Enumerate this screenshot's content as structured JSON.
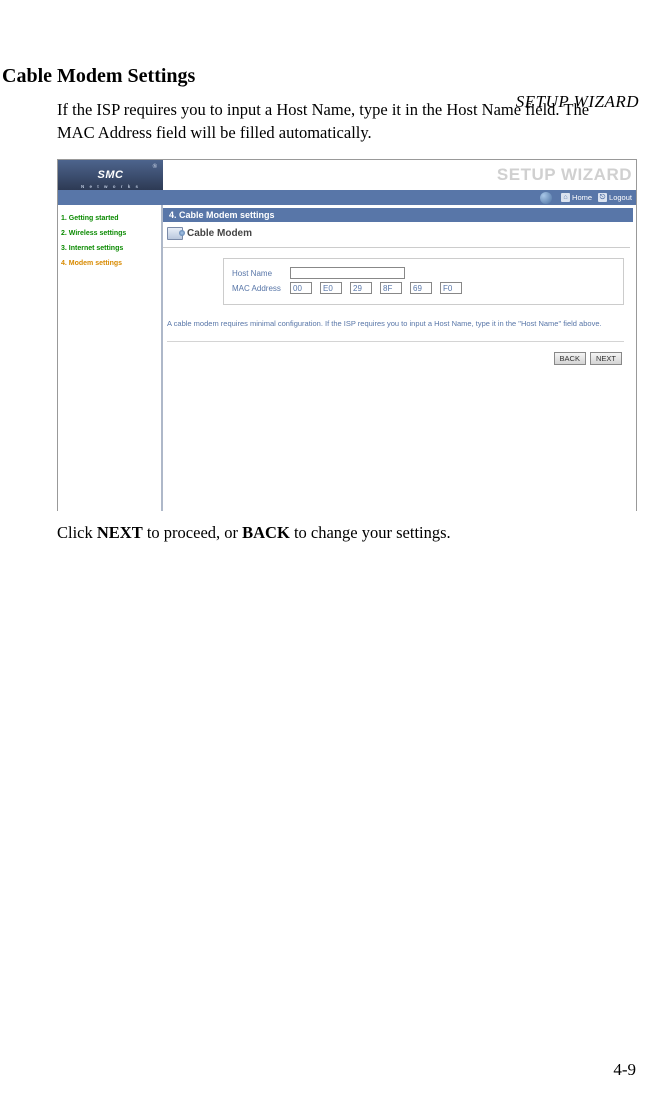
{
  "header": {
    "title": "SETUP WIZARD"
  },
  "section": {
    "heading": "Cable Modem Settings"
  },
  "intro": "If the ISP requires you to input a Host Name, type it in the Host Name field. The MAC Address field will be filled automatically.",
  "outro_parts": {
    "pre": "Click ",
    "b1": "NEXT",
    "mid": " to proceed, or ",
    "b2": "BACK",
    "post": " to change your settings."
  },
  "screenshot": {
    "logo": {
      "brand": "SMC",
      "sub": "N e t w o r k s",
      "reg": "®"
    },
    "wizard_label": "SETUP WIZARD",
    "util": {
      "home": "Home",
      "logout": "Logout"
    },
    "sidebar": [
      {
        "label": "1. Getting started",
        "active": false
      },
      {
        "label": "2. Wireless settings",
        "active": false
      },
      {
        "label": "3. Internet settings",
        "active": false
      },
      {
        "label": "4. Modem settings",
        "active": true
      }
    ],
    "step_header": "4. Cable Modem settings",
    "modem_title": "Cable Modem",
    "form": {
      "host_label": "Host Name",
      "host_value": "",
      "mac_label": "MAC Address",
      "mac": [
        "00",
        "E0",
        "29",
        "8F",
        "69",
        "F0"
      ]
    },
    "helptext": "A cable modem requires minimal configuration. If the ISP requires you to input a Host Name, type it in the \"Host Name\" field above.",
    "buttons": {
      "back": "BACK",
      "next": "NEXT"
    }
  },
  "page_number": "4-9"
}
